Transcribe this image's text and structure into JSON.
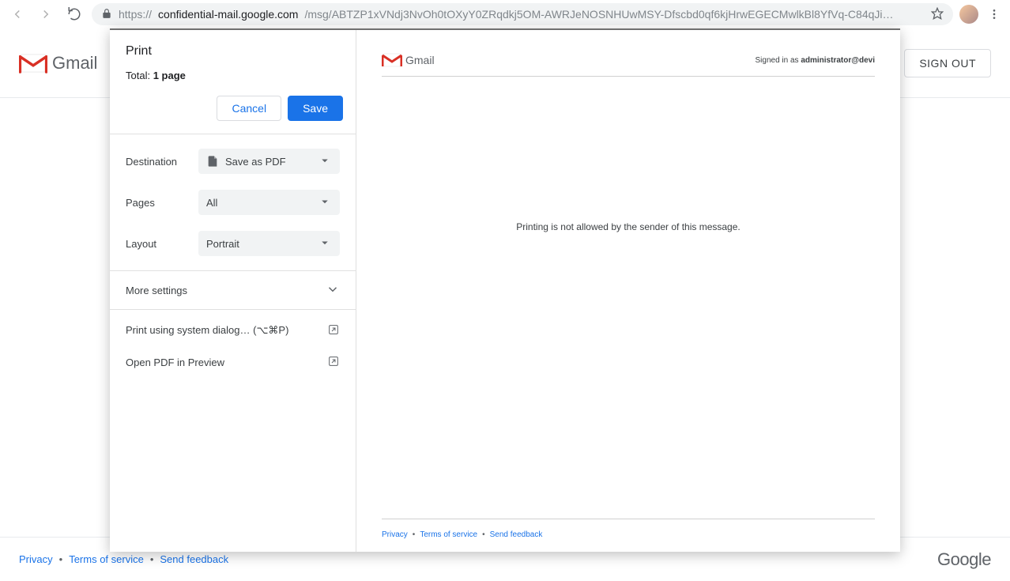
{
  "browser": {
    "host": "confidential-mail.google.com",
    "path": "/msg/ABTZP1xVNdj3NvOh0tOXyY0ZRqdkj5OM-AWRJeNOSNHUwMSY-Dfscbd0qf6kjHrwEGECMwlkBl8YfVq-C84qJi…"
  },
  "header": {
    "gmail_word": "Gmail",
    "sign_out": "SIGN OUT"
  },
  "footer": {
    "privacy": "Privacy",
    "terms": "Terms of service",
    "feedback": "Send feedback",
    "google": "Google"
  },
  "print_dialog": {
    "title": "Print",
    "total_prefix": "Total: ",
    "total_value": "1 page",
    "cancel": "Cancel",
    "save": "Save",
    "rows": {
      "destination_label": "Destination",
      "destination_value": "Save as PDF",
      "pages_label": "Pages",
      "pages_value": "All",
      "layout_label": "Layout",
      "layout_value": "Portrait"
    },
    "more_settings": "More settings",
    "system_dialog": "Print using system dialog… (⌥⌘P)",
    "open_preview": "Open PDF in Preview"
  },
  "preview": {
    "gmail_word": "Gmail",
    "signed_prefix": "Signed in as ",
    "signed_user": "administrator@devi",
    "message": "Printing is not allowed by the sender of this message.",
    "privacy": "Privacy",
    "terms": "Terms of service",
    "feedback": "Send feedback"
  }
}
